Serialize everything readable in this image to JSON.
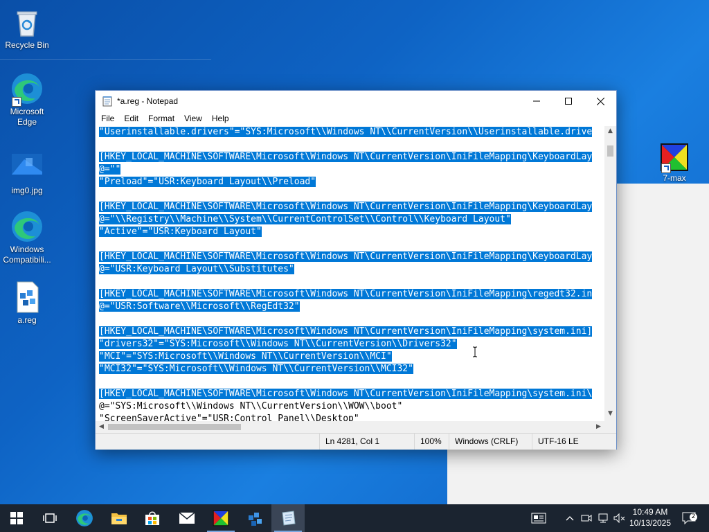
{
  "desktop": {
    "icons": [
      {
        "label": "Recycle Bin"
      },
      {
        "label": "Microsoft Edge"
      },
      {
        "label": "img0.jpg"
      },
      {
        "label": "Windows Compatibili..."
      },
      {
        "label": "a.reg"
      },
      {
        "label": "7-max"
      }
    ]
  },
  "notepad": {
    "title": "*a.reg - Notepad",
    "menu": [
      "File",
      "Edit",
      "Format",
      "View",
      "Help"
    ],
    "lines": [
      {
        "text": "\"Userinstallable.drivers\"=\"SYS:Microsoft\\\\Windows NT\\\\CurrentVersion\\\\Userinstallable.drive",
        "sel": true
      },
      {
        "text": "",
        "sel": false
      },
      {
        "text": "[HKEY_LOCAL_MACHINE\\SOFTWARE\\Microsoft\\Windows NT\\CurrentVersion\\IniFileMapping\\KeyboardLay",
        "sel": true
      },
      {
        "text": "@=\"\"",
        "sel": true
      },
      {
        "text": "\"Preload\"=\"USR:Keyboard Layout\\\\Preload\"",
        "sel": true
      },
      {
        "text": "",
        "sel": false
      },
      {
        "text": "[HKEY_LOCAL_MACHINE\\SOFTWARE\\Microsoft\\Windows NT\\CurrentVersion\\IniFileMapping\\KeyboardLay",
        "sel": true
      },
      {
        "text": "@=\"\\\\Registry\\\\Machine\\\\System\\\\CurrentControlSet\\\\Control\\\\Keyboard Layout\"",
        "sel": true
      },
      {
        "text": "\"Active\"=\"USR:Keyboard Layout\"",
        "sel": true
      },
      {
        "text": "",
        "sel": false
      },
      {
        "text": "[HKEY_LOCAL_MACHINE\\SOFTWARE\\Microsoft\\Windows NT\\CurrentVersion\\IniFileMapping\\KeyboardLay",
        "sel": true
      },
      {
        "text": "@=\"USR:Keyboard Layout\\\\Substitutes\"",
        "sel": true
      },
      {
        "text": "",
        "sel": false
      },
      {
        "text": "[HKEY_LOCAL_MACHINE\\SOFTWARE\\Microsoft\\Windows NT\\CurrentVersion\\IniFileMapping\\regedt32.in",
        "sel": true
      },
      {
        "text": "@=\"USR:Software\\\\Microsoft\\\\RegEdt32\"",
        "sel": true
      },
      {
        "text": "",
        "sel": false
      },
      {
        "text": "[HKEY_LOCAL_MACHINE\\SOFTWARE\\Microsoft\\Windows NT\\CurrentVersion\\IniFileMapping\\system.ini]",
        "sel": true
      },
      {
        "text": "\"drivers32\"=\"SYS:Microsoft\\\\Windows NT\\\\CurrentVersion\\\\Drivers32\"",
        "sel": true
      },
      {
        "text": "\"MCI\"=\"SYS:Microsoft\\\\Windows NT\\\\CurrentVersion\\\\MCI\"",
        "sel": true
      },
      {
        "text": "\"MCI32\"=\"SYS:Microsoft\\\\Windows NT\\\\CurrentVersion\\\\MCI32\"",
        "sel": true
      },
      {
        "text": "",
        "sel": false
      },
      {
        "text": "[HKEY_LOCAL_MACHINE\\SOFTWARE\\Microsoft\\Windows NT\\CurrentVersion\\IniFileMapping\\system.ini\\",
        "sel": true
      },
      {
        "text": "@=\"SYS:Microsoft\\\\Windows NT\\\\CurrentVersion\\\\WOW\\\\boot\"",
        "sel": false
      },
      {
        "text": "\"ScreenSaverActive\"=\"USR:Control Panel\\\\Desktop\"",
        "sel": false
      }
    ],
    "status": {
      "position": "Ln 4281, Col 1",
      "zoom": "100%",
      "line_endings": "Windows (CRLF)",
      "encoding": "UTF-16 LE"
    }
  },
  "taskbar": {
    "clock_time": "10:49 AM",
    "clock_date": "10/13/2025",
    "notification_count": "2",
    "apps": [
      "start",
      "task-view",
      "edge",
      "file-explorer",
      "store",
      "mail",
      "7-max",
      "reg-editor",
      "notepad"
    ]
  },
  "colors": {
    "selection": "#0078d7",
    "taskbar": "#1b2430",
    "desktop_blue": "#0e63c4"
  }
}
